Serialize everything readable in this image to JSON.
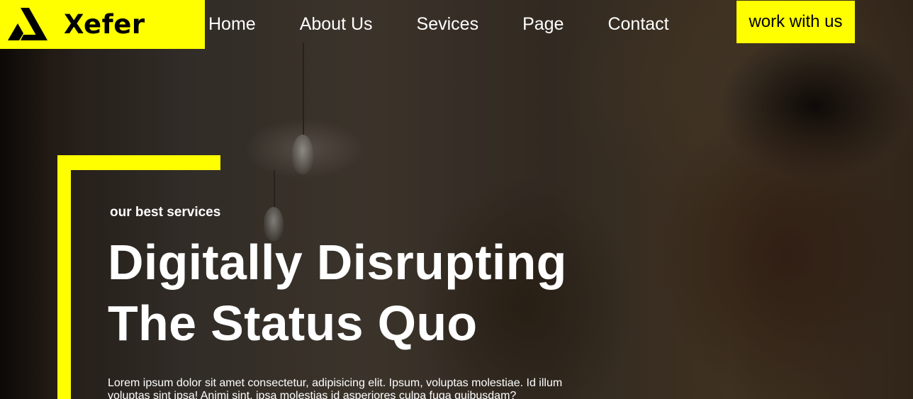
{
  "brand": {
    "name": "Xefer",
    "accent": "#ffff00",
    "logo_icon": "abstract-logo-icon"
  },
  "nav": {
    "items": [
      "Home",
      "About Us",
      "Sevices",
      "Page",
      "Contact"
    ]
  },
  "cta": {
    "label": "work with us"
  },
  "hero": {
    "eyebrow": "our best services",
    "headline_line1": "Digitally Disrupting",
    "headline_line2": "The Status Quo",
    "body": "Lorem ipsum dolor sit amet consectetur, adipisicing elit. Ipsum, voluptas molestiae. Id illum voluptas sint ipsa! Animi sint, ipsa molestias id asperiores culpa fuga quibusdam? Quibusdam tempo"
  }
}
